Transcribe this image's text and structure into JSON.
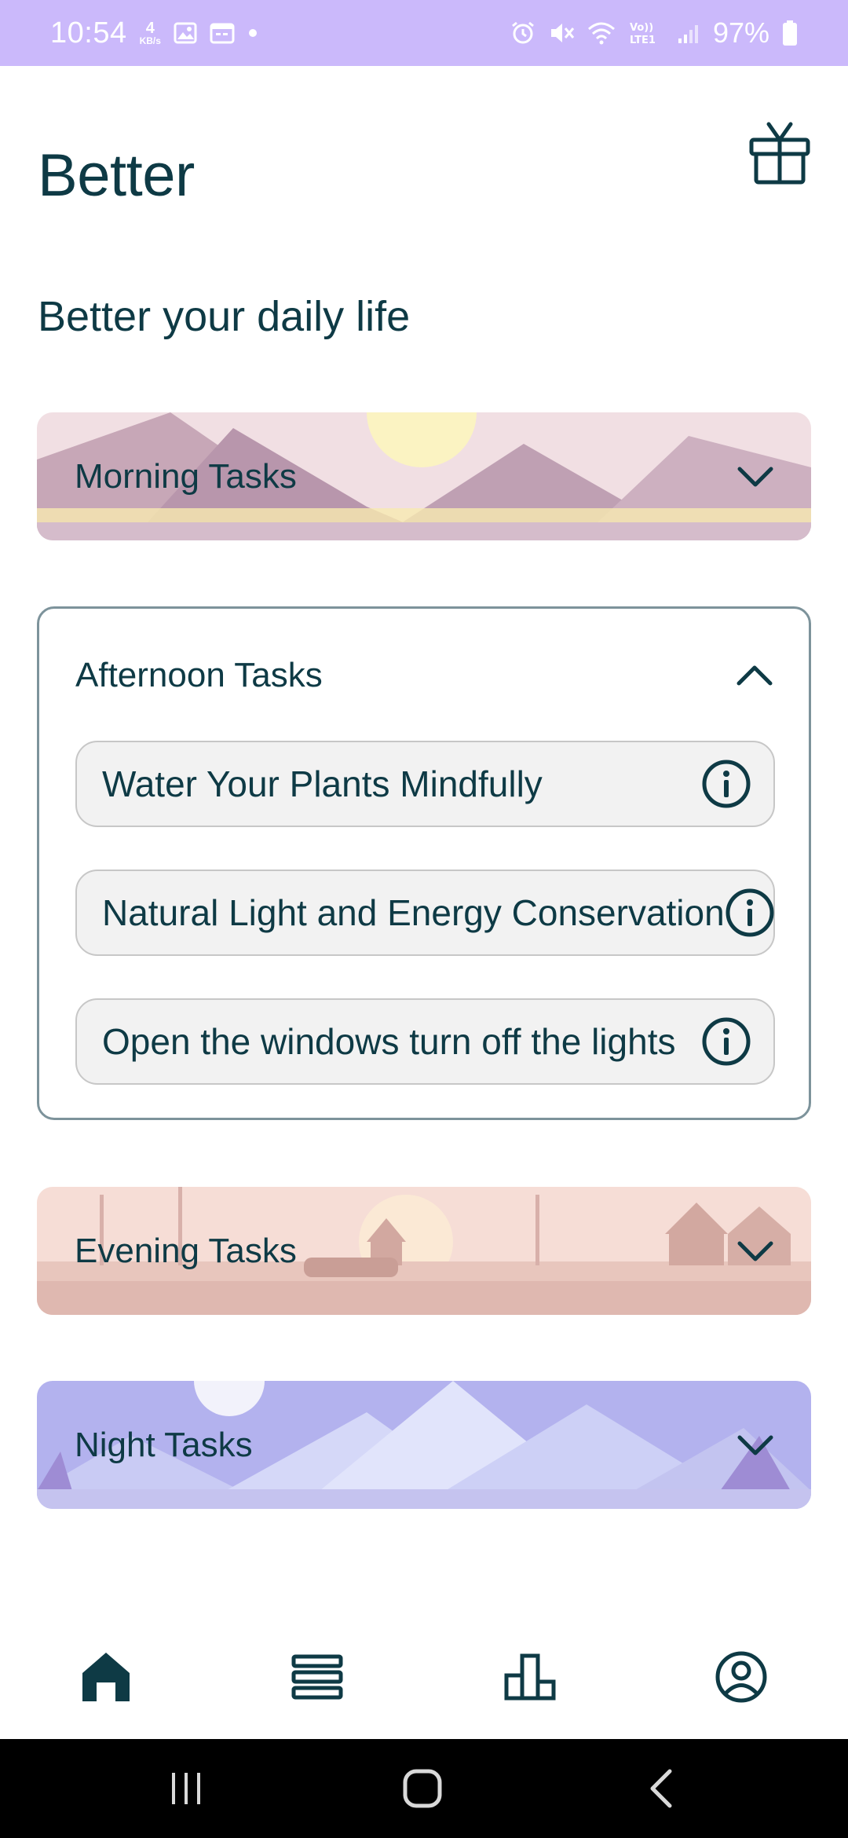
{
  "status_bar": {
    "time": "10:54",
    "net_speed_value": "4",
    "net_speed_unit": "KB/s",
    "signal_label": "Vo) LTE1",
    "battery": "97%",
    "background": "#cbb9fb"
  },
  "header": {
    "title": "Better",
    "subtitle": "Better your daily life"
  },
  "sections": {
    "morning": {
      "label": "Morning Tasks"
    },
    "afternoon": {
      "label": "Afternoon Tasks",
      "items": [
        "Water Your Plants Mindfully",
        "Natural Light and Energy Conservation",
        "Open the windows turn off the lights"
      ]
    },
    "evening": {
      "label": "Evening Tasks"
    },
    "night": {
      "label": "Night Tasks"
    }
  },
  "bottom_nav": {
    "items": [
      "home-icon",
      "list-icon",
      "leaderboard-icon",
      "profile-icon"
    ],
    "active": "home-icon"
  },
  "colors": {
    "text": "#0e3a45",
    "accent": "#cbb9fb",
    "card_border": "#7d939b"
  }
}
